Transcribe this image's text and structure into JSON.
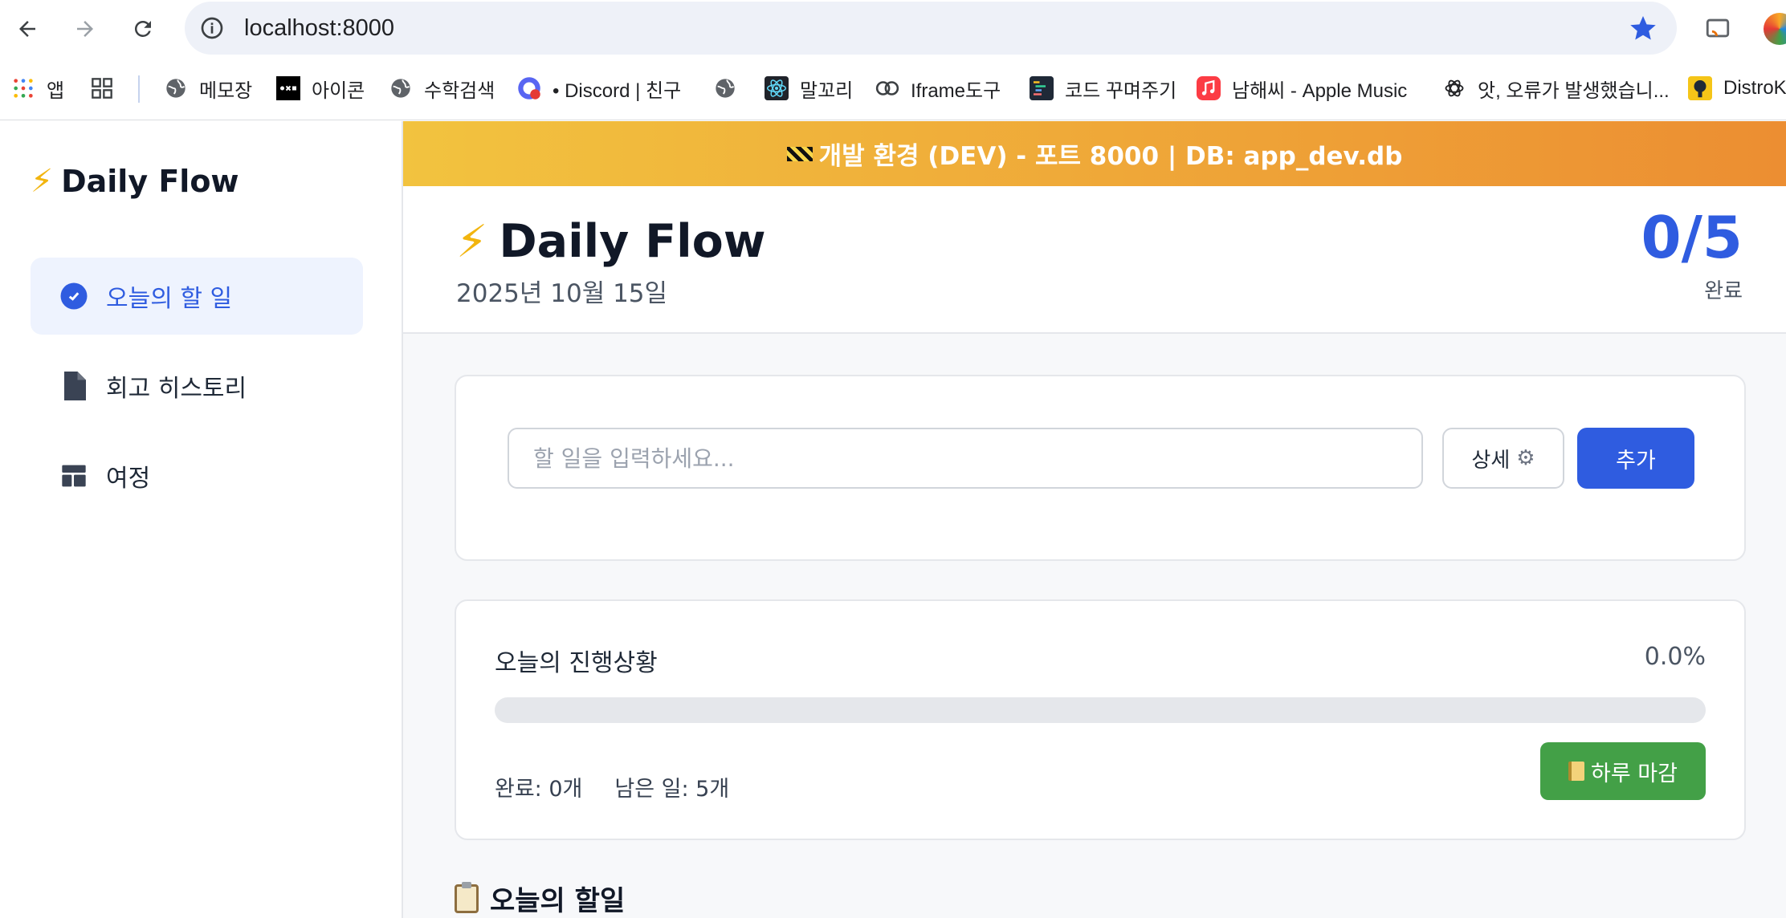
{
  "browser": {
    "url": "localhost:8000",
    "bookmarks": [
      {
        "label": "앱",
        "icon": "apps-grid-icon"
      },
      {
        "label": "",
        "icon": "tab-groups-icon"
      },
      {
        "label": "메모장",
        "icon": "globe-icon"
      },
      {
        "label": "아이콘",
        "icon": "icon-site-icon"
      },
      {
        "label": "수학검색",
        "icon": "globe-icon"
      },
      {
        "label": "• Discord | 친구",
        "icon": "discord-icon"
      },
      {
        "label": "",
        "icon": "globe-icon"
      },
      {
        "label": "말꼬리",
        "icon": "react-icon"
      },
      {
        "label": "Iframe도구",
        "icon": "rings-icon"
      },
      {
        "label": "코드 꾸며주기",
        "icon": "code-icon"
      },
      {
        "label": "남해씨 - Apple Music",
        "icon": "music-icon"
      },
      {
        "label": "앗, 오류가 발생했습니...",
        "icon": "openai-icon"
      },
      {
        "label": "DistroKi",
        "icon": "distrokid-icon"
      }
    ]
  },
  "sidebar": {
    "brand": "Daily Flow",
    "items": [
      {
        "label": "오늘의 할 일",
        "icon": "check-circle-icon",
        "active": true
      },
      {
        "label": "회고 히스토리",
        "icon": "document-icon",
        "active": false
      },
      {
        "label": "여정",
        "icon": "layout-icon",
        "active": false
      }
    ]
  },
  "banner": {
    "text": "개발 환경 (DEV) - 포트 8000 | DB: app_dev.db"
  },
  "header": {
    "title": "Daily Flow",
    "date": "2025년 10월 15일",
    "count": "0/5",
    "count_label": "완료"
  },
  "add_task": {
    "placeholder": "할 일을 입력하세요...",
    "detail_label": "상세",
    "add_label": "추가"
  },
  "progress": {
    "title": "오늘의 진행상황",
    "percent_text": "0.0%",
    "percent": 0,
    "completed_text": "완료: 0개",
    "remaining_text": "남은 일: 5개",
    "close_label": "하루 마감"
  },
  "tasks_section": {
    "title": "오늘의 할일"
  },
  "colors": {
    "accent": "#2f5ce0",
    "success": "#43a047",
    "banner_start": "#f2c33f",
    "banner_end": "#ec8e32"
  }
}
